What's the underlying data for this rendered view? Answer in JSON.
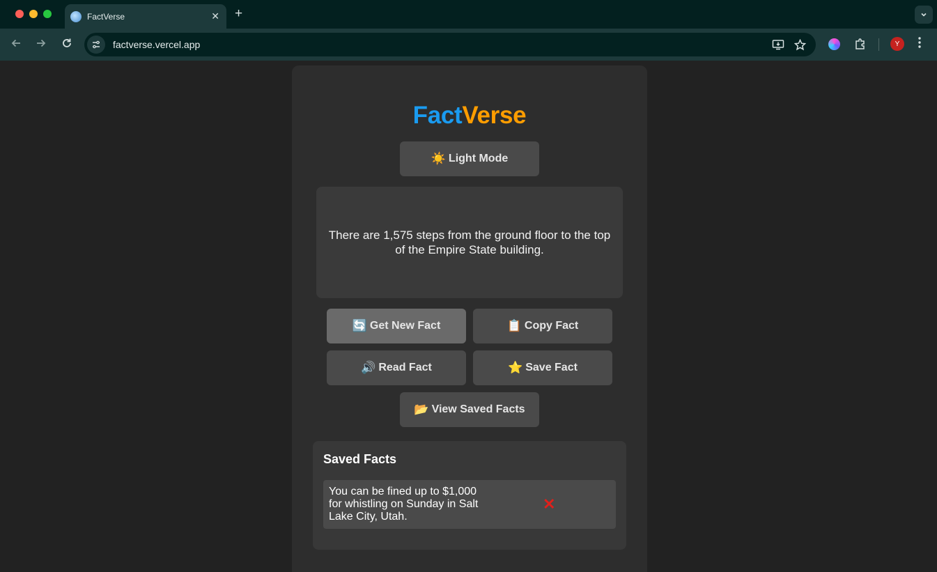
{
  "browser": {
    "tab_title": "FactVerse",
    "tab_close": "✕",
    "new_tab": "+",
    "url": "factverse.vercel.app",
    "profile_initial": "Y",
    "icons": [
      "back-icon",
      "forward-icon",
      "reload-icon",
      "site-info-icon",
      "install-app-icon",
      "bookmark-star-icon",
      "extension-color-icon",
      "extensions-puzzle-icon",
      "menu-icon"
    ]
  },
  "app": {
    "logo_part1": "Fact",
    "logo_part2": "Verse",
    "logo_colors": {
      "part1": "#1a9bf0",
      "part2": "#ff9d00"
    },
    "theme_button": {
      "icon": "☀️",
      "label": "Light Mode"
    },
    "current_fact": "There are 1,575 steps from the ground floor to the top of the Empire State building.",
    "buttons": {
      "new_fact": {
        "icon": "🔄",
        "label": "Get New Fact"
      },
      "copy_fact": {
        "icon": "📋",
        "label": "Copy Fact"
      },
      "read_fact": {
        "icon": "🔊",
        "label": "Read Fact"
      },
      "save_fact": {
        "icon": "⭐",
        "label": "Save Fact"
      },
      "view_saved": {
        "icon": "📂",
        "label": "View Saved Facts"
      }
    },
    "saved": {
      "title": "Saved Facts",
      "items": [
        {
          "text": "You can be fined up to $1,000 for whistling on Sunday in Salt Lake City, Utah.",
          "delete_icon": "✕"
        }
      ]
    }
  }
}
